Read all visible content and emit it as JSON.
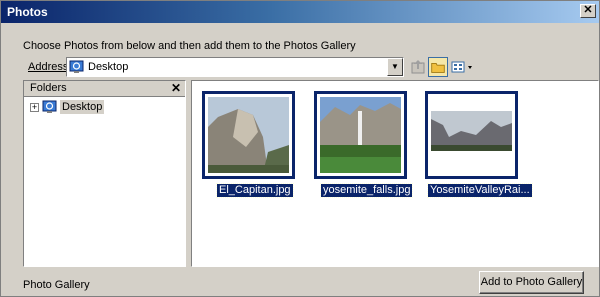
{
  "window": {
    "title": "Photos",
    "close_glyph": "✕"
  },
  "instruction": "Choose Photos from below and then add them to the Photos Gallery",
  "address": {
    "label": "Address",
    "value": "Desktop",
    "icon": "desktop-icon"
  },
  "toolbar": {
    "up_icon": "up-folder-icon",
    "folders_icon": "folders-icon",
    "views_icon": "views-icon"
  },
  "folders_pane": {
    "header": "Folders",
    "close_glyph": "✕",
    "tree": [
      {
        "label": "Desktop",
        "expander": "+",
        "icon": "desktop-icon"
      }
    ]
  },
  "files": [
    {
      "name": "El_Capitan.jpg",
      "icon": "photo-thumbnail"
    },
    {
      "name": "yosemite_falls.jpg",
      "icon": "photo-thumbnail"
    },
    {
      "name": "YosemiteValleyRai...",
      "icon": "photo-thumbnail"
    }
  ],
  "footer": {
    "label": "Photo Gallery",
    "add_button": "Add to Photo Gallery"
  }
}
